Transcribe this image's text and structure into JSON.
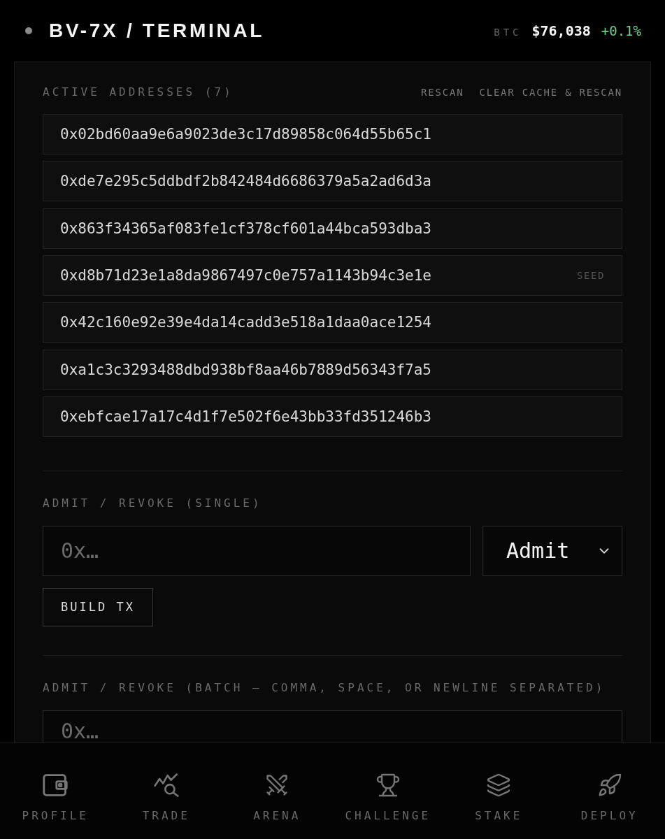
{
  "header": {
    "title": "BV-7X / TERMINAL",
    "ticker": {
      "symbol": "BTC",
      "price": "$76,038",
      "change": "+0.1%"
    }
  },
  "active_addresses": {
    "title": "ACTIVE ADDRESSES (7)",
    "actions": [
      "RESCAN",
      "CLEAR CACHE & RESCAN"
    ],
    "items": [
      {
        "address": "0x02bd60aa9e6a9023de3c17d89858c064d55b65c1"
      },
      {
        "address": "0xde7e295c5ddbdf2b842484d6686379a5a2ad6d3a"
      },
      {
        "address": "0x863f34365af083fe1cf378cf601a44bca593dba3"
      },
      {
        "address": "0xd8b71d23e1a8da9867497c0e757a1143b94c3e1e",
        "tag": "SEED"
      },
      {
        "address": "0x42c160e92e39e4da14cadd3e518a1daa0ace1254"
      },
      {
        "address": "0xa1c3c3293488dbd938bf8aa46b7889d56343f7a5"
      },
      {
        "address": "0xebfcae17a17c4d1f7e502f6e43bb33fd351246b3"
      }
    ]
  },
  "single": {
    "title": "ADMIT / REVOKE (SINGLE)",
    "input": {
      "placeholder": "0x…"
    },
    "action_select": {
      "value": "Admit"
    },
    "button": "BUILD TX"
  },
  "batch": {
    "title": "ADMIT / REVOKE (BATCH — COMMA, SPACE, OR NEWLINE SEPARATED)",
    "textarea": {
      "placeholder": "0x…"
    }
  },
  "bottom_nav": {
    "items": [
      {
        "label": "PROFILE"
      },
      {
        "label": "TRADE"
      },
      {
        "label": "ARENA"
      },
      {
        "label": "CHALLENGE"
      },
      {
        "label": "STAKE"
      },
      {
        "label": "DEPLOY"
      }
    ]
  }
}
